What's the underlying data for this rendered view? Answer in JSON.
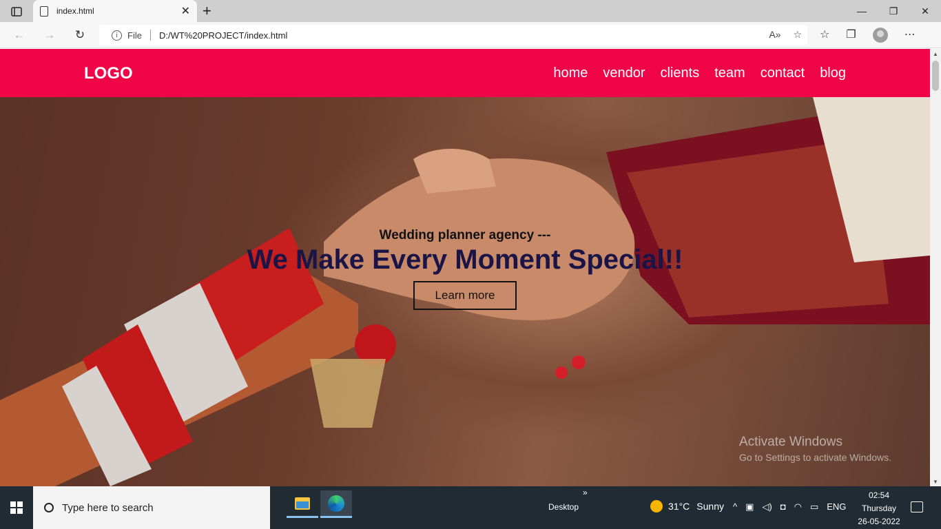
{
  "browser": {
    "tab_title": "index.html",
    "tab_close": "✕",
    "new_tab": "+",
    "window_controls": [
      "—",
      "❐",
      "✕"
    ],
    "nav": {
      "back": "←",
      "forward": "→",
      "refresh": "↻"
    },
    "address": {
      "scheme_label": "File",
      "url": "D:/WT%20PROJECT/index.html"
    }
  },
  "site": {
    "logo": "LOGO",
    "menu": [
      "home",
      "vendor",
      "clients",
      "team",
      "contact",
      "blog"
    ],
    "hero": {
      "subtitle": "Wedding planner agency ---",
      "title": "We Make Every Moment Special!!",
      "button": "Learn more"
    }
  },
  "watermark": {
    "line1": "Activate Windows",
    "line2": "Go to Settings to activate Windows."
  },
  "taskbar": {
    "search_placeholder": "Type here to search",
    "desktop_label": "Desktop",
    "weather": {
      "temp": "31°C",
      "condition": "Sunny"
    },
    "language": "ENG",
    "time": "02:54",
    "day": "Thursday",
    "date": "26-05-2022"
  },
  "colors": {
    "navbar": "#ef0548",
    "hero_title": "#1b1446"
  }
}
